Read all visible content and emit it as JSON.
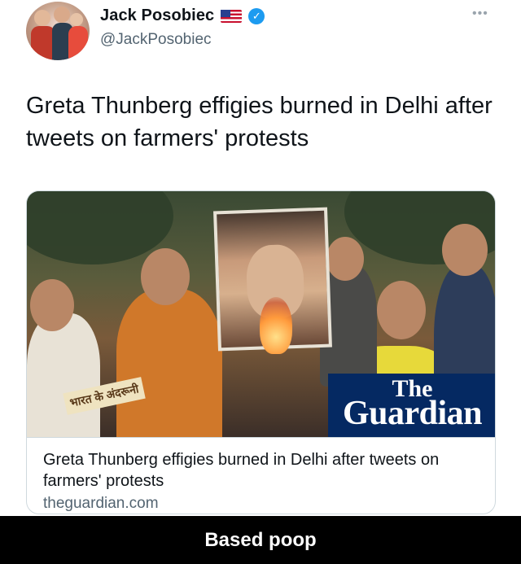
{
  "author": {
    "display_name": "Jack Posobiec",
    "handle": "@JackPosobiec",
    "flag_icon": "us-flag-icon",
    "verified_icon": "verified-badge-icon",
    "accent_color": "#1d9bf0"
  },
  "tweet": {
    "text": "Greta Thunberg effigies burned in Delhi after tweets on farmers' protests",
    "more_label": "•••"
  },
  "link_card": {
    "sign_text": "भारत के अंदरूनी",
    "logo_the": "The",
    "logo_name": "Guardian",
    "logo_bg_color": "#052962",
    "title": "Greta Thunberg effigies burned in Delhi after tweets on farmers' protests",
    "domain": "theguardian.com"
  },
  "caption": {
    "text": "Based poop"
  }
}
